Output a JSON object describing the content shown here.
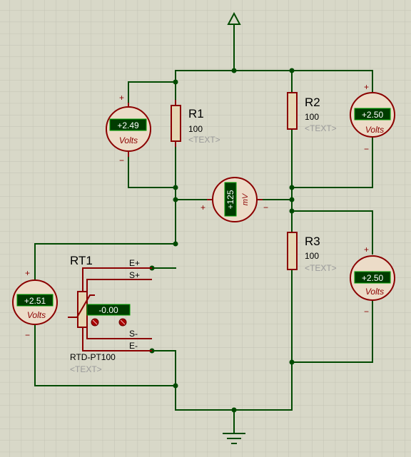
{
  "colors": {
    "background": "#d8d8c8",
    "grid": "#c2c2b4",
    "wire": "#004a00",
    "component": "#8b0000",
    "meter_fill": "#ecdcc8",
    "resistor_fill": "#e6d8b4",
    "lcd_bg": "#003c00",
    "lcd_text": "#ffffff",
    "placeholder_text": "#9a9a9a"
  },
  "components": {
    "r1": {
      "ref": "R1",
      "value": "100",
      "text": "<TEXT>"
    },
    "r2": {
      "ref": "R2",
      "value": "100",
      "text": "<TEXT>"
    },
    "r3": {
      "ref": "R3",
      "value": "100",
      "text": "<TEXT>"
    },
    "rt1": {
      "ref": "RT1",
      "model": "RTD-PT100",
      "text": "<TEXT>",
      "reading": "-0.00",
      "pins": {
        "e_plus": "E+",
        "s_plus": "S+",
        "s_minus": "S-",
        "e_minus": "E-"
      }
    }
  },
  "meters": {
    "vm1": {
      "reading": "+2.49",
      "unit": "Volts",
      "plus": "+",
      "minus": "−"
    },
    "vm2": {
      "reading": "+2.50",
      "unit": "Volts",
      "plus": "+",
      "minus": "−"
    },
    "vm3": {
      "reading": "+2.50",
      "unit": "Volts",
      "plus": "+",
      "minus": "−"
    },
    "vm4": {
      "reading": "+2.51",
      "unit": "Volts",
      "plus": "+",
      "minus": "−"
    },
    "mv": {
      "reading": "+125",
      "unit": "mV",
      "plus": "+",
      "minus": "−"
    }
  }
}
